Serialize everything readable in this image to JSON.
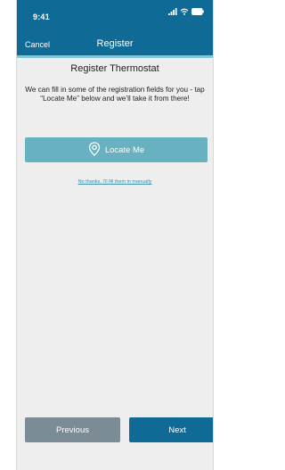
{
  "status_bar": {
    "time": "9:41"
  },
  "nav": {
    "cancel_label": "Cancel",
    "title": "Register"
  },
  "content": {
    "heading": "Register Thermostat",
    "description": "We can fill in some of the registration fields for you - tap “Locate Me” below and we’ll take it from there!",
    "locate_button": {
      "icon": "location-pin-icon",
      "label": "Locate Me"
    },
    "manual_link": "No thanks, I’ll fill them in manually"
  },
  "footer": {
    "previous_label": "Previous",
    "next_label": "Next"
  },
  "colors": {
    "header": "#0f6a96",
    "accent_underline": "#7ec6da",
    "locate_button": "#68b1c0",
    "previous_button": "#7b8c96",
    "next_button": "#0f6a96",
    "background": "#eeeeee"
  }
}
